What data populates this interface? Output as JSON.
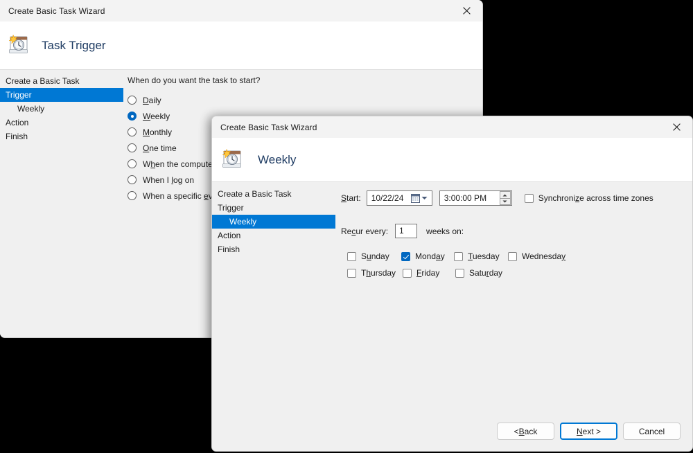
{
  "back_window": {
    "title": "Create Basic Task Wizard",
    "icon": "task-scheduler-icon",
    "close_icon": "close-icon",
    "page_title": "Task Trigger",
    "sidebar": [
      {
        "label": "Create a Basic Task",
        "selected": false,
        "sub": false
      },
      {
        "label": "Trigger",
        "selected": true,
        "sub": false
      },
      {
        "label": "Weekly",
        "selected": false,
        "sub": true
      },
      {
        "label": "Action",
        "selected": false,
        "sub": false
      },
      {
        "label": "Finish",
        "selected": false,
        "sub": false
      }
    ],
    "prompt": "When do you want the task to start?",
    "options": [
      {
        "label": "Daily",
        "mnemonic": "D",
        "checked": false
      },
      {
        "label": "Weekly",
        "mnemonic": "W",
        "checked": true
      },
      {
        "label": "Monthly",
        "mnemonic": "M",
        "checked": false
      },
      {
        "label": "One time",
        "mnemonic": "O",
        "checked": false
      },
      {
        "label": "When the computer starts",
        "mnemonic": "h",
        "checked": false
      },
      {
        "label": "When I log on",
        "mnemonic": "l",
        "checked": false
      },
      {
        "label": "When a specific event is logged",
        "mnemonic": "e",
        "checked": false
      }
    ]
  },
  "front_window": {
    "title": "Create Basic Task Wizard",
    "icon": "task-scheduler-icon",
    "close_icon": "close-icon",
    "page_title": "Weekly",
    "sidebar": [
      {
        "label": "Create a Basic Task",
        "selected": false,
        "sub": false
      },
      {
        "label": "Trigger",
        "selected": false,
        "sub": false
      },
      {
        "label": "Weekly",
        "selected": true,
        "sub": true
      },
      {
        "label": "Action",
        "selected": false,
        "sub": false
      },
      {
        "label": "Finish",
        "selected": false,
        "sub": false
      }
    ],
    "start": {
      "label": "Start:",
      "label_mnemonic": "S",
      "date_value": "10/22/24",
      "date_icon": "calendar-icon",
      "dropdown_icon": "chevron-down-icon",
      "time_value": "3:00:00 PM",
      "spinner_up_icon": "spinner-up-icon",
      "spinner_down_icon": "spinner-down-icon"
    },
    "sync": {
      "label": "Synchronize across time zones",
      "mnemonic": "z",
      "checked": false
    },
    "recur": {
      "label_before": "Recur every:",
      "label_mnemonic": "c",
      "value": "1",
      "label_after": "weeks on:"
    },
    "days": [
      {
        "label": "Sunday",
        "mnemonic": "u",
        "checked": false
      },
      {
        "label": "Monday",
        "mnemonic": "a",
        "checked": true
      },
      {
        "label": "Tuesday",
        "mnemonic": "T",
        "checked": false
      },
      {
        "label": "Wednesday",
        "mnemonic": "y",
        "checked": false
      },
      {
        "label": "Thursday",
        "mnemonic": "h",
        "checked": false
      },
      {
        "label": "Friday",
        "mnemonic": "F",
        "checked": false
      },
      {
        "label": "Saturday",
        "mnemonic": "r",
        "checked": false
      }
    ],
    "buttons": {
      "back": {
        "label": "< Back",
        "mnemonic": "B",
        "default": false
      },
      "next": {
        "label": "Next >",
        "mnemonic": "N",
        "default": true
      },
      "cancel": {
        "label": "Cancel",
        "mnemonic": "",
        "default": false
      }
    }
  },
  "colors": {
    "accent": "#0078d4",
    "accent_control": "#0067c0",
    "window_bg": "#f0f0f0",
    "header_bg": "#ffffff",
    "title_bg": "#f3f3f3"
  }
}
